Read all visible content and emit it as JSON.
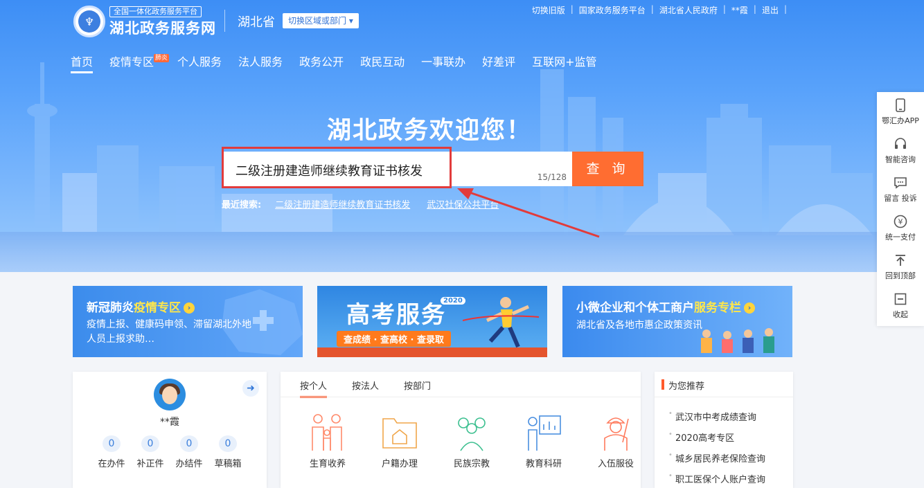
{
  "header": {
    "brand_tag": "全国一体化政务服务平台",
    "brand_title": "湖北政务服务网",
    "province": "湖北省",
    "switch_label": "切换区域或部门 ▾",
    "top_links": [
      "切换旧版",
      "国家政务服务平台",
      "湖北省人民政府",
      "**霞",
      "退出"
    ]
  },
  "nav": {
    "items": [
      "首页",
      "疫情专区",
      "个人服务",
      "法人服务",
      "政务公开",
      "政民互动",
      "一事联办",
      "好差评",
      "互联网+监管"
    ],
    "badge": "肺炎"
  },
  "hero": {
    "welcome": "湖北政务欢迎您！",
    "search_value": "二级注册建造师继续教育证书核发",
    "search_count": "15/128",
    "search_button": "查 询",
    "recent_label": "最近搜索:",
    "recent_links": [
      "二级注册建造师继续教育证书核发",
      "武汉社保公共平台"
    ]
  },
  "side_bar": {
    "items": [
      {
        "label": "鄂汇办APP",
        "icon": "phone-icon"
      },
      {
        "label": "智能咨询",
        "icon": "headset-icon"
      },
      {
        "label": "留言 投诉",
        "icon": "message-icon"
      },
      {
        "label": "统一支付",
        "icon": "yuan-icon"
      },
      {
        "label": "回到顶部",
        "icon": "back-to-top-icon"
      },
      {
        "label": "收起",
        "icon": "collapse-icon"
      }
    ]
  },
  "banners": {
    "covid": {
      "title_a": "新冠肺炎",
      "title_b": "疫情专区",
      "desc": "疫情上报、健康码申领、滞留湖北外地人员上报求助…"
    },
    "gaokao": {
      "title": "高考服务",
      "year": "2020",
      "sub": "查成绩 · 查高校 · 查录取"
    },
    "sme": {
      "title_a": "小微企业和个体工商户",
      "title_b": "服务专栏",
      "desc": "湖北省及各地市惠企政策资讯"
    }
  },
  "user": {
    "name": "**霞",
    "stats": [
      {
        "num": "0",
        "label": "在办件"
      },
      {
        "num": "0",
        "label": "补正件"
      },
      {
        "num": "0",
        "label": "办结件"
      },
      {
        "num": "0",
        "label": "草稿箱"
      }
    ]
  },
  "services": {
    "tabs": [
      "按个人",
      "按法人",
      "按部门"
    ],
    "items": [
      {
        "label": "生育收养",
        "icon": "family-icon"
      },
      {
        "label": "户籍办理",
        "icon": "household-icon"
      },
      {
        "label": "民族宗教",
        "icon": "ethnic-icon"
      },
      {
        "label": "教育科研",
        "icon": "education-icon"
      },
      {
        "label": "入伍服役",
        "icon": "military-icon"
      }
    ]
  },
  "recommend": {
    "title": "为您推荐",
    "items": [
      "武汉市中考成绩查询",
      "2020高考专区",
      "城乡居民养老保险查询",
      "职工医保个人账户查询"
    ]
  },
  "colors": {
    "accent": "#ff6d31",
    "primary": "#3d8ef5",
    "highlight": "#e23b3b"
  }
}
